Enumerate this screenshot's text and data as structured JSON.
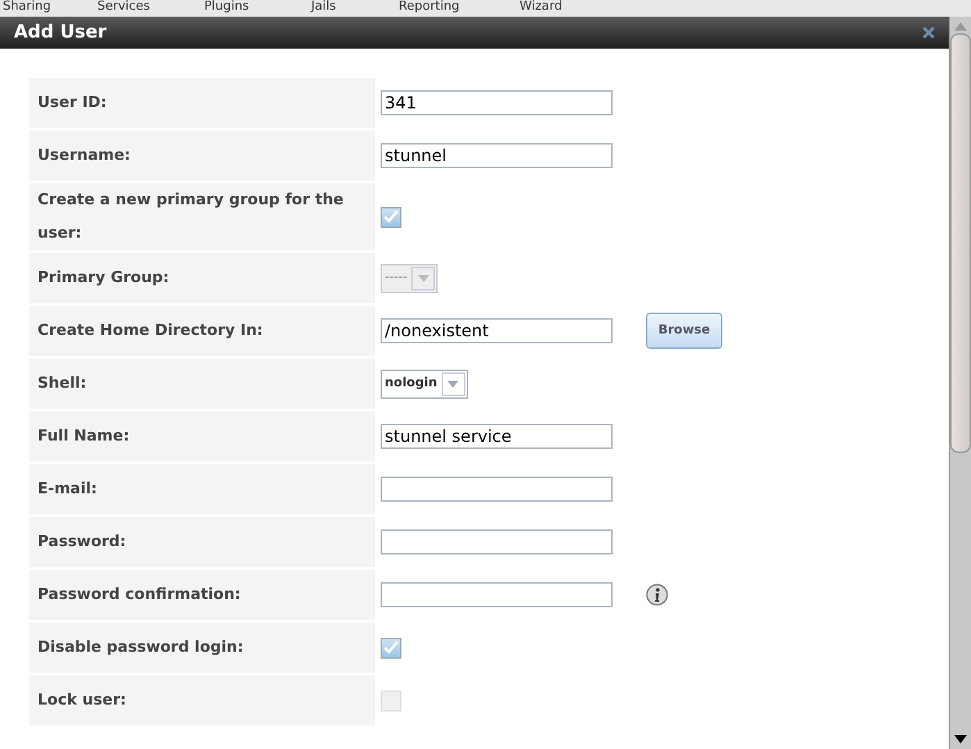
{
  "background_menu": [
    "Sharing",
    "Services",
    "Plugins",
    "Jails",
    "Reporting",
    "Wizard"
  ],
  "dialog": {
    "title": "Add User"
  },
  "fields": [
    {
      "kind": "text",
      "label": "User ID:",
      "value": "341"
    },
    {
      "kind": "text",
      "label": "Username:",
      "value": "stunnel"
    },
    {
      "kind": "checkbox",
      "label": "Create a new primary group for the user:",
      "checked": true,
      "disabled": false
    },
    {
      "kind": "select",
      "label": "Primary Group:",
      "value": "-----",
      "disabled": true
    },
    {
      "kind": "text",
      "label": "Create Home Directory In:",
      "value": "/nonexistent",
      "button": "Browse"
    },
    {
      "kind": "select",
      "label": "Shell:",
      "value": "nologin",
      "disabled": false
    },
    {
      "kind": "text",
      "label": "Full Name:",
      "value": "stunnel service"
    },
    {
      "kind": "text",
      "label": "E-mail:"
    },
    {
      "kind": "text",
      "label": "Password:"
    },
    {
      "kind": "text",
      "label": "Password confirmation:",
      "info": true
    },
    {
      "kind": "checkbox",
      "label": "Disable password login:",
      "checked": true,
      "disabled": false
    },
    {
      "kind": "checkbox",
      "label": "Lock user:",
      "checked": false,
      "disabled": true
    }
  ]
}
